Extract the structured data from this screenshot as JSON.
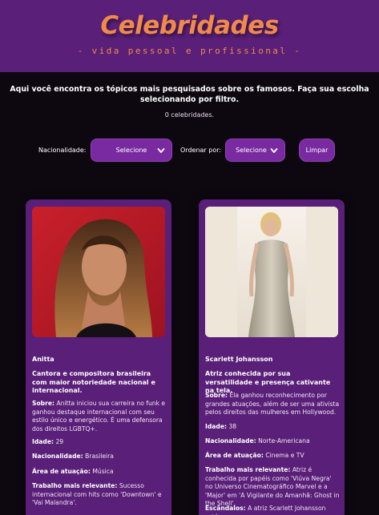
{
  "header": {
    "logo": "Celebridades",
    "tagline": "- vida pessoal e profissional -"
  },
  "intro": "Aqui você encontra os tópicos mais pesquisados sobre os famosos. Faça sua escolha selecionando por filtro.",
  "count": "0 celebridades.",
  "filters": {
    "nationality_label": "Nacionalidade:",
    "nationality_value": "Selecione",
    "order_label": "Ordenar por:",
    "order_value": "Selecione",
    "clear_button": "Limpar"
  },
  "cards": [
    {
      "name": "Anitta",
      "headline": "Cantora e compositora brasileira com maior notoriedade nacional e internacional.",
      "about_label": "Sobre:",
      "about": "Anitta iniciou sua carreira no funk e ganhou destaque internacional com seu estilo único e energético. É uma defensora dos direitos LGBTQ+.",
      "age_label": "Idade:",
      "age": "29",
      "nationality_label": "Nacionalidade:",
      "nationality": "Brasileira",
      "area_label": "Área de atuação:",
      "area": "Música",
      "work_label": "Trabalho mais relevante:",
      "work": "Sucesso internacional com hits como 'Downtown' e 'Vai Malandra'."
    },
    {
      "name": "Scarlett Johansson",
      "headline": "Atriz conhecida por sua versatilidade e presença cativante na tela.",
      "about_label": "Sobre:",
      "about": "Ela ganhou reconhecimento por grandes atuações, além de ser uma ativista pelos direitos das mulheres em Hollywood.",
      "age_label": "Idade:",
      "age": "38",
      "nationality_label": "Nacionalidade:",
      "nationality": "Norte-Americana",
      "area_label": "Área de atuação:",
      "area": "Cinema e TV",
      "work_label": "Trabalho mais relevante:",
      "work": "Atriz é conhecida por papéis como 'Viúva Negra' no Universo Cinematográfico Marvel e a 'Major' em 'A Vigilante do Amanhã: Ghost in the Shell'.",
      "scandal_label": "Escândalos:",
      "scandal": "A atriz Scarlett Johansson está"
    }
  ],
  "colors": {
    "header_bg": "#5a1f78",
    "accent_orange": "#f08a4b",
    "button_purple": "#7a2aa0",
    "page_bg": "#0d0810"
  }
}
